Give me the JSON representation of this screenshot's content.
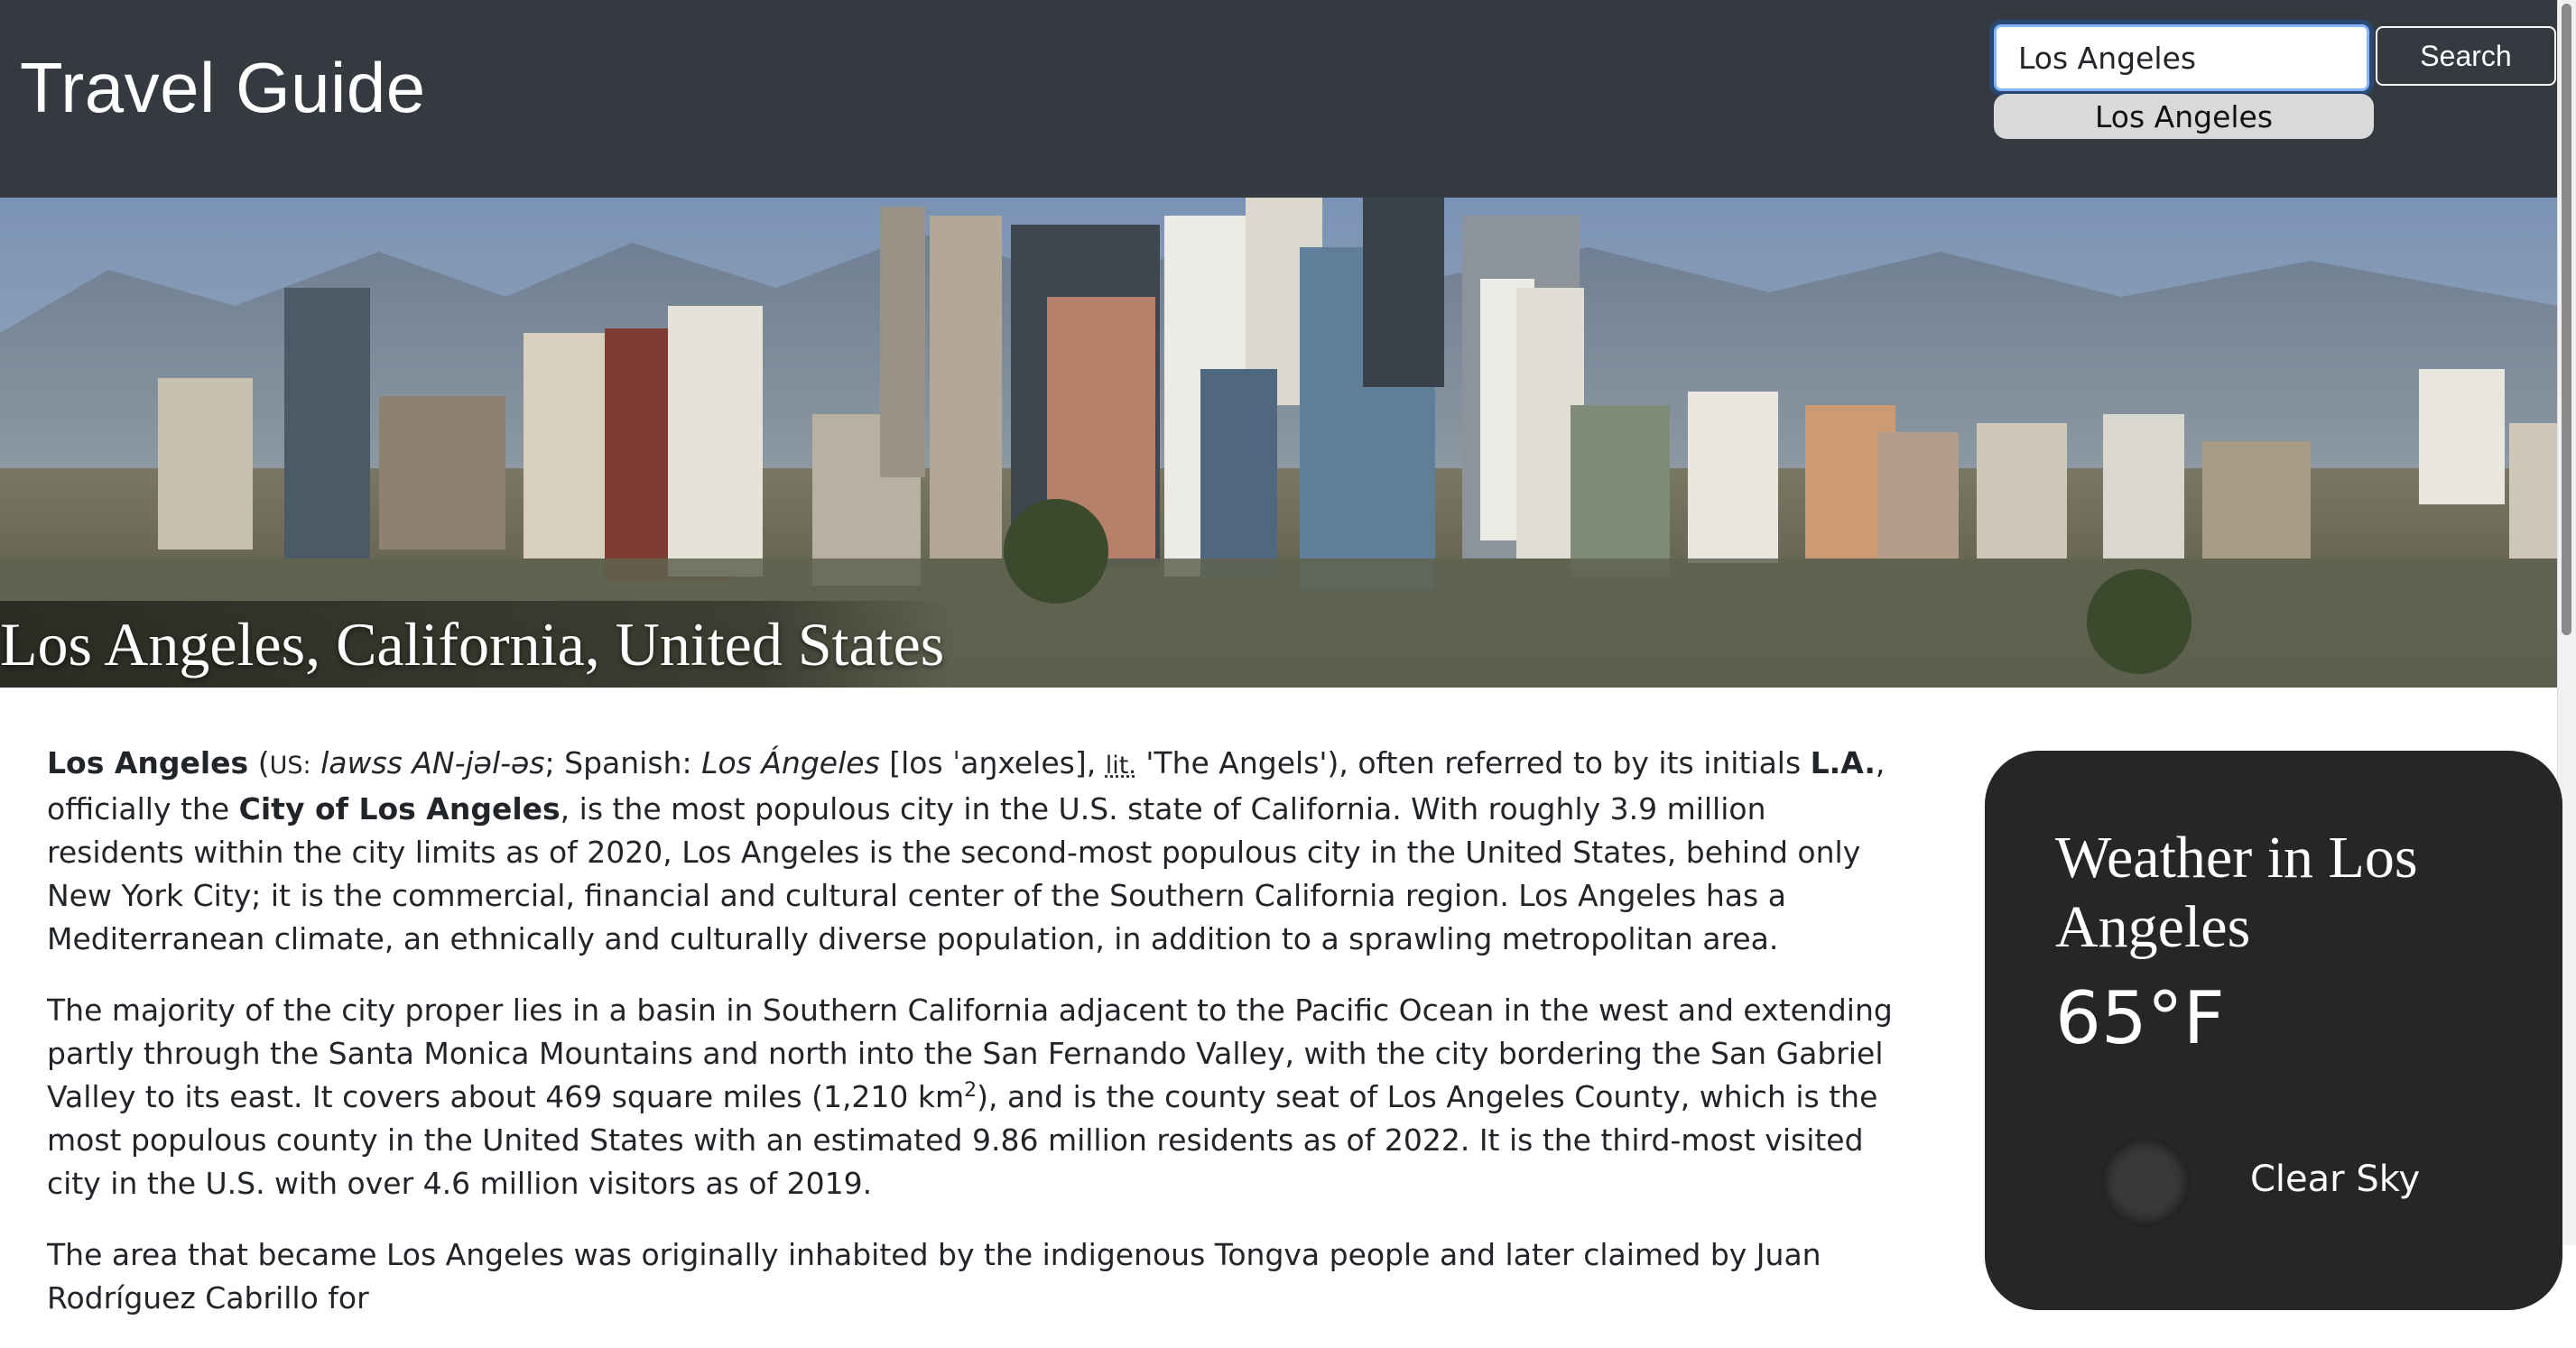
{
  "header": {
    "title": "Travel Guide",
    "search": {
      "value": "Los Angeles",
      "placeholder": ""
    },
    "search_button": "Search",
    "suggestions": [
      "Los Angeles"
    ]
  },
  "hero": {
    "caption": "Los Angeles, California, United States"
  },
  "article": {
    "p1": {
      "name": "Los Angeles",
      "pron_open": " (",
      "us": "US:",
      "pron_space": " ",
      "ipa": "lawss AN-jəl-əs",
      "spanish_label": "; Spanish: ",
      "spanish_name": "Los Ángeles",
      "spanish_ipa": " [los ˈaŋxeles], ",
      "lit": "lit.",
      "meaning": " 'The Angels'), often referred to by its initials ",
      "initials": "L.A.",
      "officially": ", officially the ",
      "official_name": "City of Los Angeles",
      "rest": ", is the most populous city in the U.S. state of California. With roughly 3.9 million residents within the city limits as of 2020, Los Angeles is the second-most populous city in the United States, behind only New York City; it is the commercial, financial and cultural center of the Southern California region. Los Angeles has a Mediterranean climate, an ethnically and culturally diverse population, in addition to a sprawling metropolitan area."
    },
    "p2": {
      "before_sup": "The majority of the city proper lies in a basin in Southern California adjacent to the Pacific Ocean in the west and extending partly through the Santa Monica Mountains and north into the San Fernando Valley, with the city bordering the San Gabriel Valley to its east. It covers about 469 square miles (1,210 km",
      "sup": "2",
      "after_sup": "), and is the county seat of Los Angeles County, which is the most populous county in the United States with an estimated 9.86 million residents as of 2022. It is the third-most visited city in the U.S. with over 4.6 million visitors as of 2019."
    },
    "p3": "The area that became Los Angeles was originally inhabited by the indigenous Tongva people and later claimed by Juan Rodríguez Cabrillo for"
  },
  "weather": {
    "title": "Weather in Los Angeles",
    "temperature": "65°F",
    "condition": "Clear Sky",
    "icon": "weather-condition-icon"
  },
  "colors": {
    "header_bg": "#343a40",
    "weather_card_bg": "#262626",
    "suggestion_bg": "#d9d9d9",
    "focus_ring": "#86b7fe"
  }
}
